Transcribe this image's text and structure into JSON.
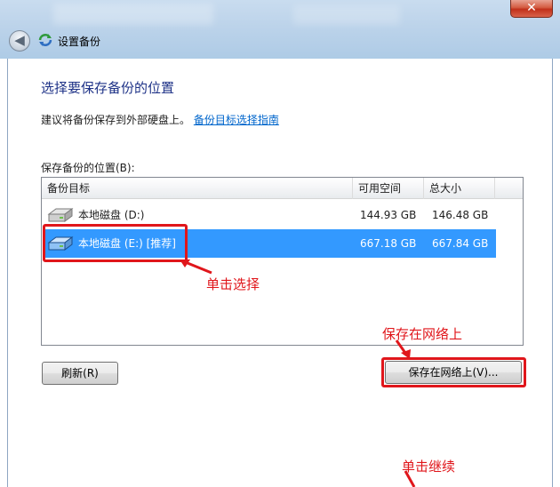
{
  "window": {
    "title": "设置备份",
    "close_glyph": "✕"
  },
  "nav": {
    "back_glyph": "◀"
  },
  "heading": "选择要保存备份的位置",
  "advice": {
    "text": "建议将备份保存到外部硬盘上。",
    "link": "备份目标选择指南"
  },
  "location_label": "保存备份的位置(B):",
  "table": {
    "columns": [
      "备份目标",
      "可用空间",
      "总大小"
    ],
    "rows": [
      {
        "name": "本地磁盘 (D:)",
        "free": "144.93 GB",
        "total": "146.48 GB",
        "selected": false,
        "icon": "hard-drive-icon"
      },
      {
        "name": "本地磁盘 (E:) [推荐]",
        "free": "667.18 GB",
        "total": "667.84 GB",
        "selected": true,
        "icon": "hard-drive-icon"
      }
    ]
  },
  "buttons": {
    "refresh": "刷新(R)",
    "save_network": "保存在网络上(V)..."
  },
  "annotations": {
    "click_select": "单击选择",
    "save_network": "保存在网络上",
    "click_continue": "单击继续"
  },
  "colors": {
    "selection": "#3399ff",
    "annotation_red": "#e0161b",
    "heading_blue": "#1e3287"
  }
}
